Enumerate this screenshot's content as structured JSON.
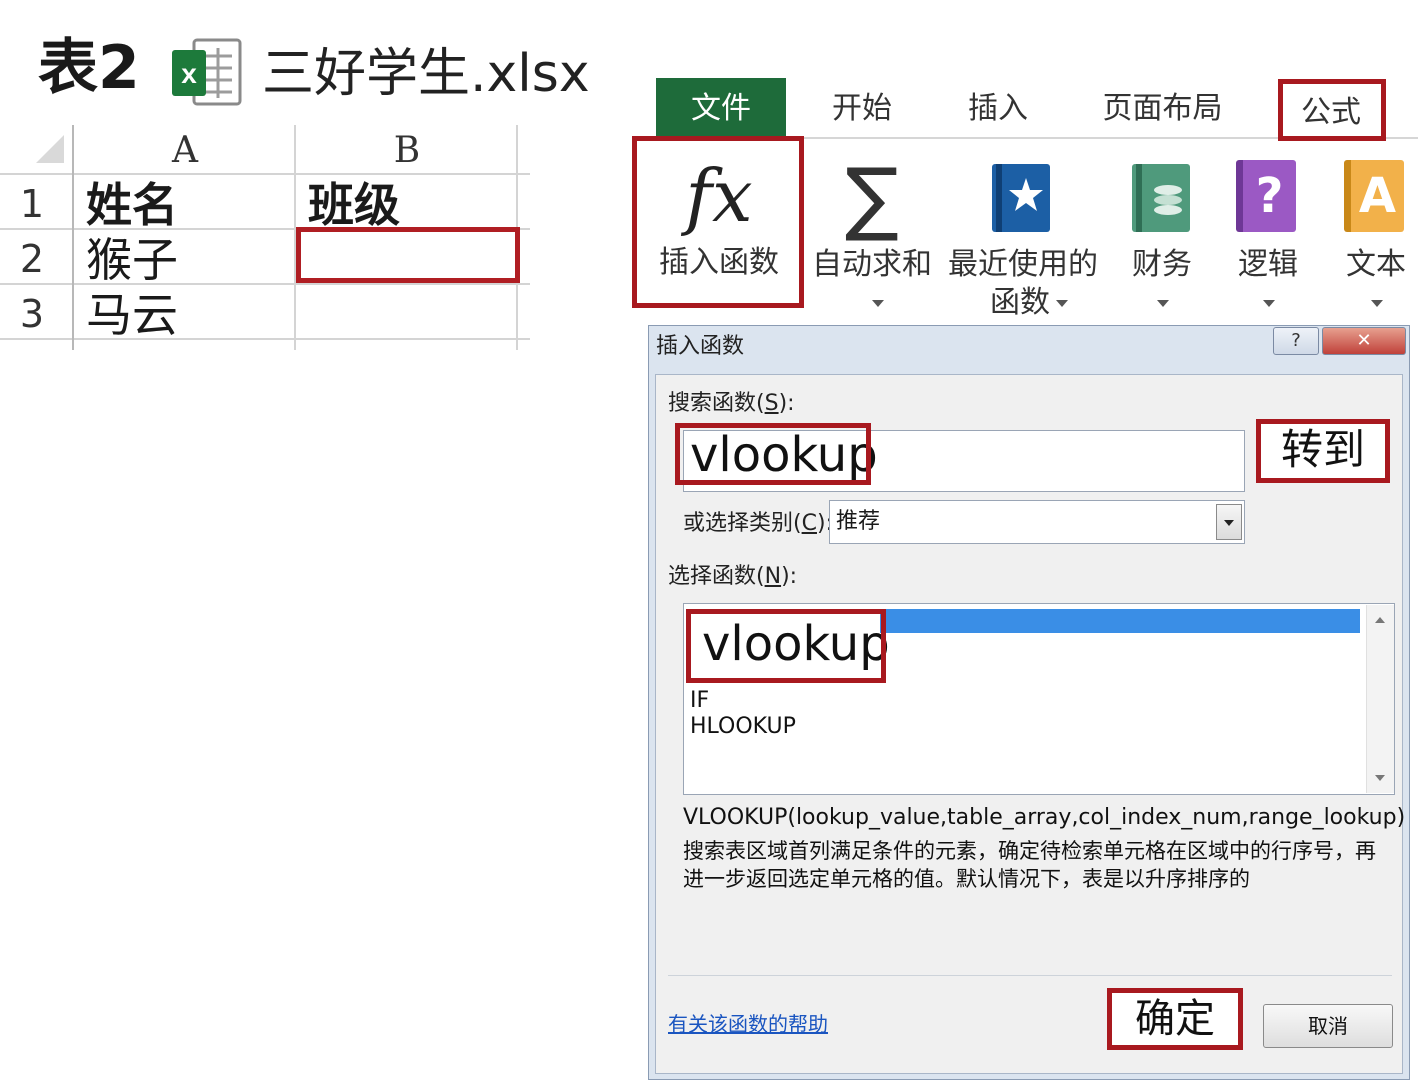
{
  "header": {
    "table_label": "表2",
    "file_name": "三好学生.xlsx"
  },
  "sheet": {
    "columns": [
      "A",
      "B"
    ],
    "rows": [
      {
        "num": "1",
        "a": "姓名",
        "b": "班级"
      },
      {
        "num": "2",
        "a": "猴子",
        "b": ""
      },
      {
        "num": "3",
        "a": "马云",
        "b": ""
      }
    ]
  },
  "ribbon": {
    "tabs": [
      "文件",
      "开始",
      "插入",
      "页面布局",
      "公式"
    ],
    "fx_symbol": "fx",
    "sigma_symbol": "∑",
    "insert_function": "插入函数",
    "autosum": "自动求和",
    "recent_line1": "最近使用的",
    "recent_line2": "函数",
    "finance": "财务",
    "logic": "逻辑",
    "logic_glyph": "?",
    "text": "文本",
    "text_glyph": "A",
    "colors": {
      "file_tab": "#1e6b3a",
      "highlight_red": "#a8191f"
    }
  },
  "dialog": {
    "title": "插入函数",
    "help_glyph": "?",
    "close_glyph": "✕",
    "search_label_pre": "搜索函数(",
    "search_label_key": "S",
    "search_label_post": "):",
    "search_value": "vlookup",
    "goto_label": "转到",
    "category_label_pre": "或选择类别(",
    "category_label_key": "C",
    "category_label_post": "):",
    "category_value": "推荐",
    "select_label_pre": "选择函数(",
    "select_label_key": "N",
    "select_label_post": "):",
    "functions": [
      "vlookup",
      "IF",
      "HLOOKUP"
    ],
    "syntax": "VLOOKUP(lookup_value,table_array,col_index_num,range_lookup)",
    "description": "搜索表区域首列满足条件的元素，确定待检索单元格在区域中的行序号，再进一步返回选定单元格的值。默认情况下，表是以升序排序的",
    "help_link": "有关该函数的帮助",
    "ok_label": "确定",
    "cancel_label": "取消"
  }
}
